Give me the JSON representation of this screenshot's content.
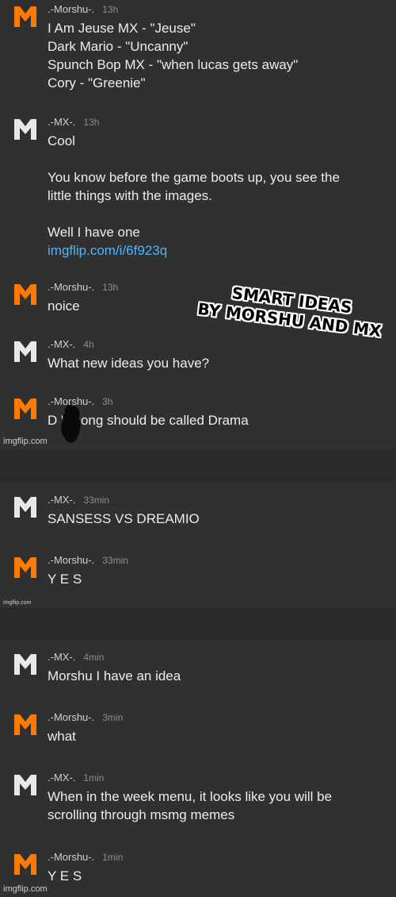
{
  "colors": {
    "orange": "#ff7a00",
    "white_avatar": "#e8e8e8",
    "link": "#4fb3ff"
  },
  "messages": [
    {
      "user": ".-Morshu-.",
      "time": "13h",
      "avatar": "orange",
      "text": "I Am Jeuse MX - \"Jeuse\"\nDark Mario - \"Uncanny\"\nSpunch Bop MX - \"when lucas gets away\"\nCory - \"Greenie\""
    },
    {
      "user": ".-MX-.",
      "time": "13h",
      "avatar": "white",
      "text": "Cool\n\nYou know before the game boots up, you see the\nlittle things with the images.\n\nWell I have one",
      "link": "imgflip.com/i/6f923q"
    },
    {
      "user": ".-Morshu-.",
      "time": "13h",
      "avatar": "orange",
      "text": "noice"
    },
    {
      "user": ".-MX-.",
      "time": "4h",
      "avatar": "white",
      "text": "What new ideas you have?"
    },
    {
      "user": ".-Morshu-.",
      "time": "3h",
      "avatar": "orange",
      "text": "D     's song should be called Drama"
    },
    {
      "user": ".-MX-.",
      "time": "33min",
      "avatar": "white",
      "text": "SANSESS VS DREAMIO"
    },
    {
      "user": ".-Morshu-.",
      "time": "33min",
      "avatar": "orange",
      "text": "Y E S"
    },
    {
      "user": ".-MX-.",
      "time": "4min",
      "avatar": "white",
      "text": "Morshu I have an idea"
    },
    {
      "user": ".-Morshu-.",
      "time": "3min",
      "avatar": "orange",
      "text": "what"
    },
    {
      "user": ".-MX-.",
      "time": "1min",
      "avatar": "white",
      "text": "When in the week menu, it looks like you will be\nscrolling through msmg memes"
    },
    {
      "user": ".-Morshu-.",
      "time": "1min",
      "avatar": "orange",
      "text": "Y E S"
    }
  ],
  "watermarks": [
    "imgflip.com",
    "imgflip.com",
    "imgflip.com"
  ],
  "caption": "SMART IDEAS\nBY MORSHU AND MX"
}
